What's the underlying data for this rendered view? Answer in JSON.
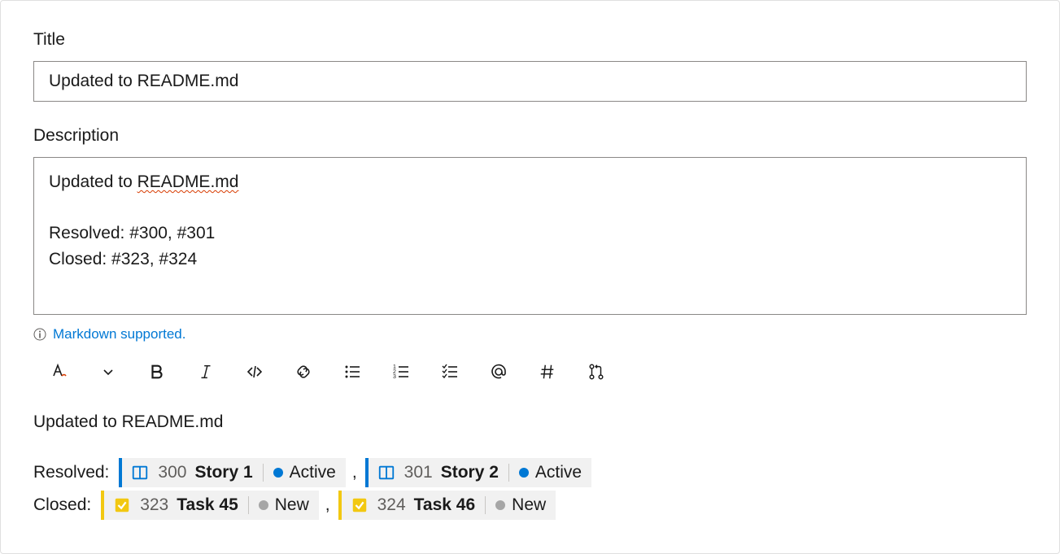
{
  "title_field": {
    "label": "Title",
    "value": "Updated to README.md"
  },
  "description_field": {
    "label": "Description",
    "line1_plain": "Updated to ",
    "line1_squiggle": "README.md",
    "line_blank": "",
    "line3": "Resolved: #300, #301",
    "line4": "Closed: #323, #324"
  },
  "markdown_hint": {
    "text": "Markdown supported."
  },
  "toolbar": [
    "text-style",
    "chevron-down",
    "bold",
    "italic",
    "code",
    "link",
    "bullet-list",
    "numbered-list",
    "checklist",
    "mention",
    "hash",
    "pull-request"
  ],
  "preview": {
    "heading": "Updated to README.md",
    "rows": [
      {
        "label": "Resolved:",
        "items": [
          {
            "kind": "story",
            "id": "300",
            "name": "Story 1",
            "status": "Active",
            "status_dot": "active"
          },
          {
            "kind": "story",
            "id": "301",
            "name": "Story 2",
            "status": "Active",
            "status_dot": "active"
          }
        ]
      },
      {
        "label": "Closed:",
        "items": [
          {
            "kind": "task",
            "id": "323",
            "name": "Task 45",
            "status": "New",
            "status_dot": "new"
          },
          {
            "kind": "task",
            "id": "324",
            "name": "Task 46",
            "status": "New",
            "status_dot": "new"
          }
        ]
      }
    ],
    "comma": ","
  }
}
